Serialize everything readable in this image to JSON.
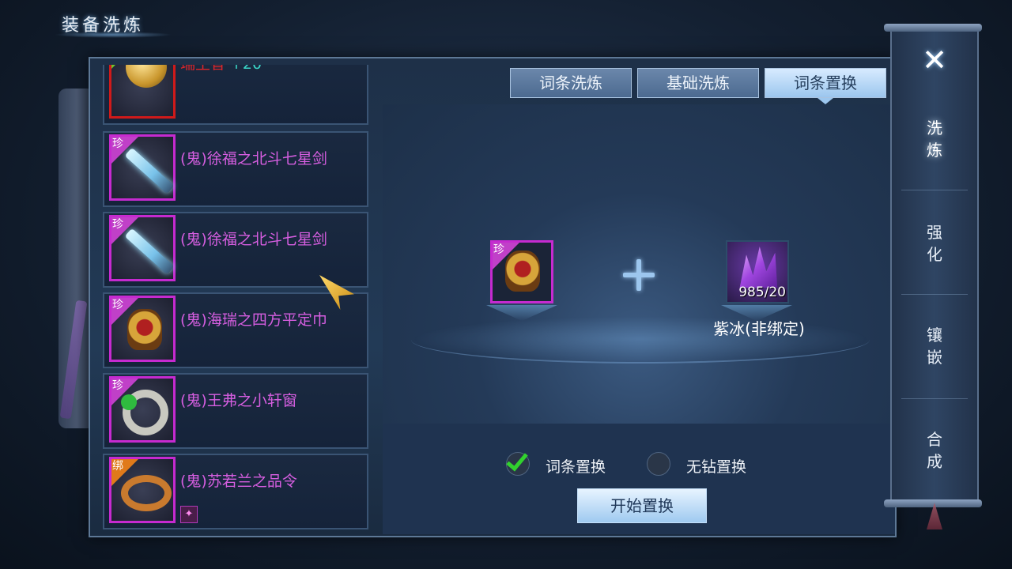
{
  "page": {
    "title": "装备洗炼"
  },
  "items": [
    {
      "name": "瑞生香",
      "bonus": "+20",
      "rarity": "",
      "color": "#e0262a"
    },
    {
      "name": "(鬼)徐福之北斗七星剑",
      "rarity": "珍",
      "color": "#d65ee0"
    },
    {
      "name": "(鬼)徐福之北斗七星剑",
      "rarity": "珍",
      "color": "#d65ee0"
    },
    {
      "name": "(鬼)海瑞之四方平定巾",
      "rarity": "珍",
      "color": "#d65ee0"
    },
    {
      "name": "(鬼)王弗之小轩窗",
      "rarity": "珍",
      "color": "#d65ee0"
    },
    {
      "name": "(鬼)苏若兰之品令",
      "rarity": "绑",
      "color": "#d65ee0"
    }
  ],
  "tabs": [
    {
      "label": "词条洗炼",
      "active": false
    },
    {
      "label": "基础洗炼",
      "active": false
    },
    {
      "label": "词条置换",
      "active": true
    }
  ],
  "workspace": {
    "equip_rarity": "珍",
    "material_count": "985/20",
    "material_name": "紫冰(非绑定)"
  },
  "options": {
    "entry_swap": {
      "label": "词条置换",
      "checked": true
    },
    "no_diamond_swap": {
      "label": "无钻置换",
      "checked": false
    }
  },
  "start_button": "开始置换",
  "sidebar": {
    "close": "✕",
    "tabs": [
      "洗\n炼",
      "强\n化",
      "镶\n嵌",
      "合\n成"
    ]
  },
  "colors": {
    "accent": "#9cc6ee",
    "rare_border": "#c62ad0",
    "check": "#31d22e"
  }
}
